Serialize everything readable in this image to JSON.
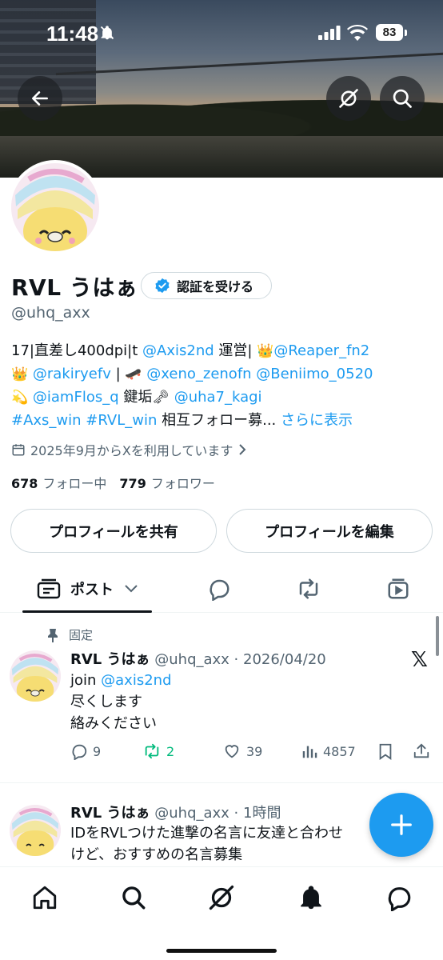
{
  "status_bar": {
    "time": "11:48",
    "battery": "83"
  },
  "profile": {
    "name": "RVL うはぁ",
    "verify_label": "認証を受ける",
    "handle": "@uhq_axx",
    "bio": {
      "l1_text": "17|直差し400dpi|t ",
      "l1_link1": "@Axis2nd",
      "l1_mid": " 運営| ",
      "l1_emoji": "👑",
      "l1_link2": "@Reaper_fn2",
      "l2_emoji": "👑",
      "l2_link1": " @rakiryefv",
      "l2_mid": " | ",
      "l2_emoji2": "🛹",
      "l2_link2": " @xeno_zenofn",
      "l2_link3": " @Beniimo_0520",
      "l3_emoji": "💫",
      "l3_link1": " @iamFlos_q",
      "l3_mid": " 鍵垢",
      "l3_emoji2": "🗝",
      "l3_link2": " @uha7_kagi",
      "l4_link1": " #Axs_win",
      "l4_link2": " #RVL_win",
      "l4_text": " 相互フォロー募...",
      "l4_more": "さらに表示"
    },
    "joined": "2025年9月からXを利用しています",
    "following_count": "678",
    "following_label": "フォロー中",
    "followers_count": "779",
    "followers_label": "フォロワー",
    "share_button": "プロフィールを共有",
    "edit_button": "プロフィールを編集"
  },
  "tabs": {
    "posts_label": "ポスト"
  },
  "posts": [
    {
      "pinned_label": "固定",
      "name": "RVL うはぁ",
      "meta": " @uhq_axx · 2026/04/20",
      "line1_text": "join ",
      "line1_link": "@axis2nd",
      "line2": "尽くします",
      "line3": "絡みください",
      "replies": "9",
      "reposts": "2",
      "likes": "39",
      "views": "4857"
    },
    {
      "name": "RVL うはぁ",
      "meta": " @uhq_axx · 1時間",
      "line1": "IDをRVLつけた進撃の名言に友達と合わせ",
      "line2": "けど、おすすめの名言募集"
    }
  ],
  "colors": {
    "accent": "#1d9bf0",
    "repost_active": "#00ba7c",
    "text": "#0f1419",
    "secondary": "#536471"
  }
}
